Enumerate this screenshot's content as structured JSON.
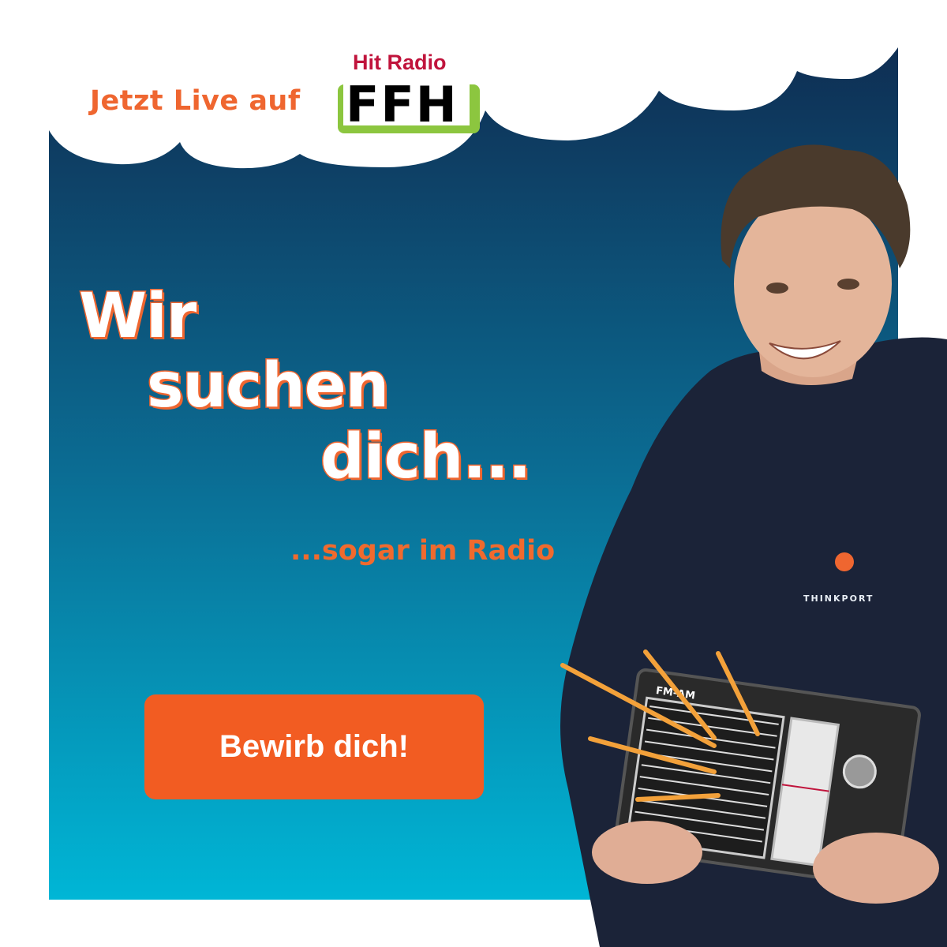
{
  "header": {
    "live_text": "Jetzt Live auf",
    "logo": {
      "top_text": "Hit Radio",
      "main_text": "FFH"
    }
  },
  "headline": {
    "line1": "Wir",
    "line2": "suchen",
    "line3": "dich..."
  },
  "subline": "...sogar im Radio",
  "cta": {
    "label": "Bewirb dich!"
  },
  "photo": {
    "shirt_logo": "THINKPORT",
    "radio_label": "FM-AM"
  },
  "colors": {
    "accent": "#f25c22",
    "gradient_top": "#0f2d52",
    "gradient_bottom": "#00b6d6",
    "logo_green": "#8cc63f",
    "logo_red": "#c0143c"
  }
}
